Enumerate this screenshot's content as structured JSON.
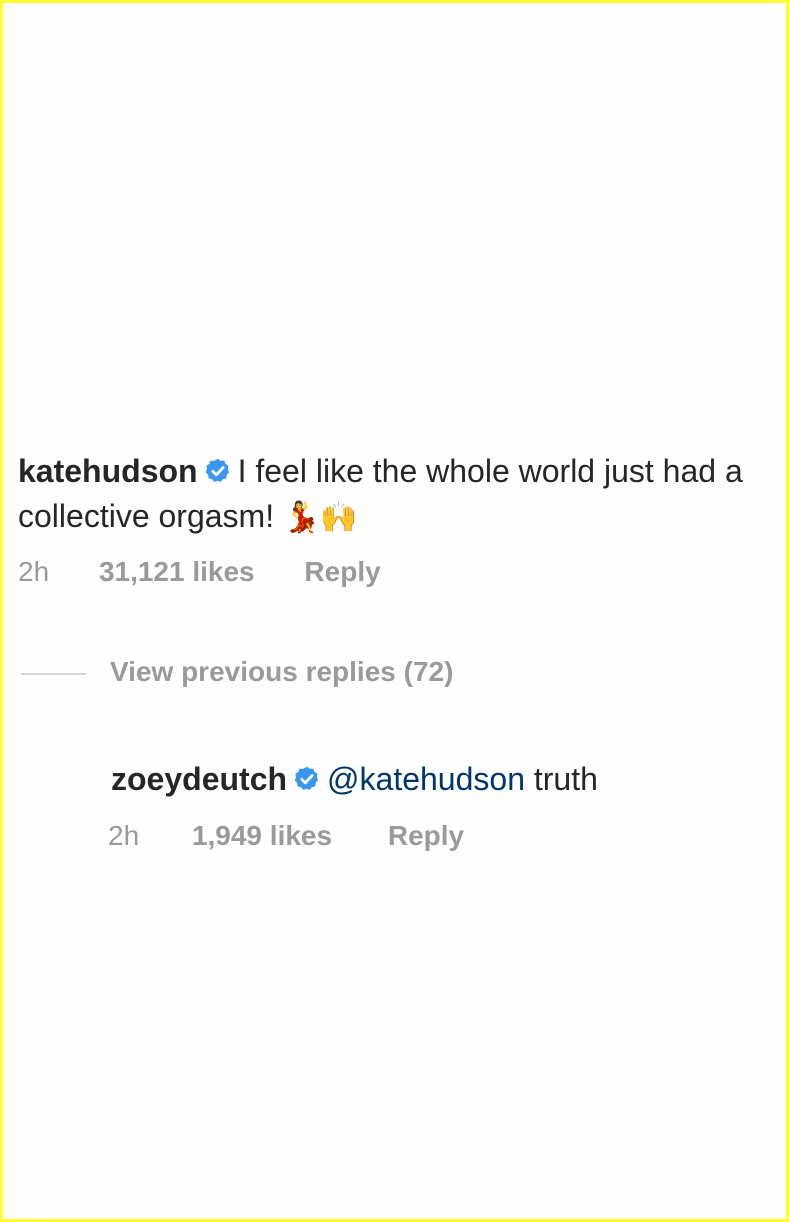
{
  "comment": {
    "username": "katehudson",
    "verified_icon": "verified-badge-icon",
    "text": "I feel like the whole world just had a collective orgasm!",
    "emojis": "💃🙌",
    "time": "2h",
    "likes": "31,121 likes",
    "reply_label": "Reply"
  },
  "view_previous": {
    "label": "View previous replies (72)"
  },
  "reply": {
    "username": "zoeydeutch",
    "verified_icon": "verified-badge-icon",
    "mention": "@katehudson",
    "text": "truth",
    "time": "2h",
    "likes": "1,949 likes",
    "reply_label": "Reply"
  },
  "colors": {
    "border": "#ffff33",
    "text": "#262626",
    "muted": "#9a9a9a",
    "verified": "#3897f0",
    "mention": "#00376b"
  }
}
